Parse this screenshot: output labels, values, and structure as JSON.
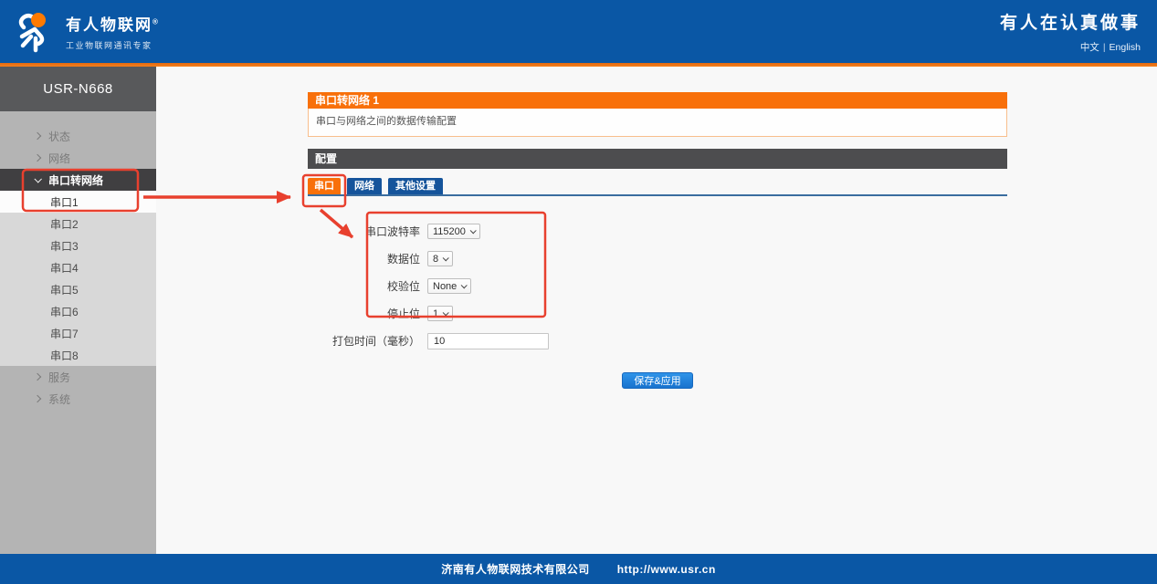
{
  "header": {
    "logo": {
      "title": "有人物联网",
      "subtitle": "工业物联网通讯专家",
      "reg": "®"
    },
    "slogan": "有人在认真做事",
    "lang": {
      "zh": "中文",
      "divider": "|",
      "en": "English"
    }
  },
  "sidebar": {
    "device": "USR-N668",
    "items": [
      {
        "id": "status",
        "label": "状态",
        "type": "parent",
        "chevron": "right",
        "state": "normal"
      },
      {
        "id": "network",
        "label": "网络",
        "type": "parent",
        "chevron": "right",
        "state": "normal"
      },
      {
        "id": "uart-net",
        "label": "串口转网络",
        "type": "parent",
        "chevron": "down",
        "state": "expanded"
      },
      {
        "id": "uart1",
        "label": "串口1",
        "type": "child",
        "state": "selected"
      },
      {
        "id": "uart2",
        "label": "串口2",
        "type": "child",
        "state": "normal"
      },
      {
        "id": "uart3",
        "label": "串口3",
        "type": "child",
        "state": "normal"
      },
      {
        "id": "uart4",
        "label": "串口4",
        "type": "child",
        "state": "normal"
      },
      {
        "id": "uart5",
        "label": "串口5",
        "type": "child",
        "state": "normal"
      },
      {
        "id": "uart6",
        "label": "串口6",
        "type": "child",
        "state": "normal"
      },
      {
        "id": "uart7",
        "label": "串口7",
        "type": "child",
        "state": "normal"
      },
      {
        "id": "uart8",
        "label": "串口8",
        "type": "child",
        "state": "normal"
      },
      {
        "id": "service",
        "label": "服务",
        "type": "parent",
        "chevron": "right",
        "state": "normal"
      },
      {
        "id": "system",
        "label": "系统",
        "type": "parent",
        "chevron": "right",
        "state": "normal"
      }
    ]
  },
  "main": {
    "panel": {
      "title": "串口转网络 1",
      "description": "串口与网络之间的数据传输配置"
    },
    "section_title": "配置",
    "tabs": [
      {
        "id": "serial",
        "label": "串口",
        "active": true
      },
      {
        "id": "network",
        "label": "网络",
        "active": false
      },
      {
        "id": "other-settings",
        "label": "其他设置",
        "active": false
      }
    ],
    "form": {
      "fields": [
        {
          "id": "baud-rate",
          "label": "串口波特率",
          "type": "select",
          "value": "115200"
        },
        {
          "id": "data-bits",
          "label": "数据位",
          "type": "select",
          "value": "8"
        },
        {
          "id": "parity",
          "label": "校验位",
          "type": "select",
          "value": "None"
        },
        {
          "id": "stop-bits",
          "label": "停止位",
          "type": "select",
          "value": "1"
        },
        {
          "id": "pack-time",
          "label": "打包时间（毫秒）",
          "type": "text",
          "value": "10"
        }
      ],
      "save_button": "保存&应用"
    }
  },
  "footer": {
    "company": "济南有人物联网技术有限公司",
    "url": "http://www.usr.cn"
  },
  "colors": {
    "navy": "#0A57A5",
    "orange": "#F8700A",
    "dark_gray": "#4D4D4F",
    "tab_blue": "#15549B",
    "button_blue": "#1C7EDB",
    "annotation_red": "#E8402E"
  }
}
